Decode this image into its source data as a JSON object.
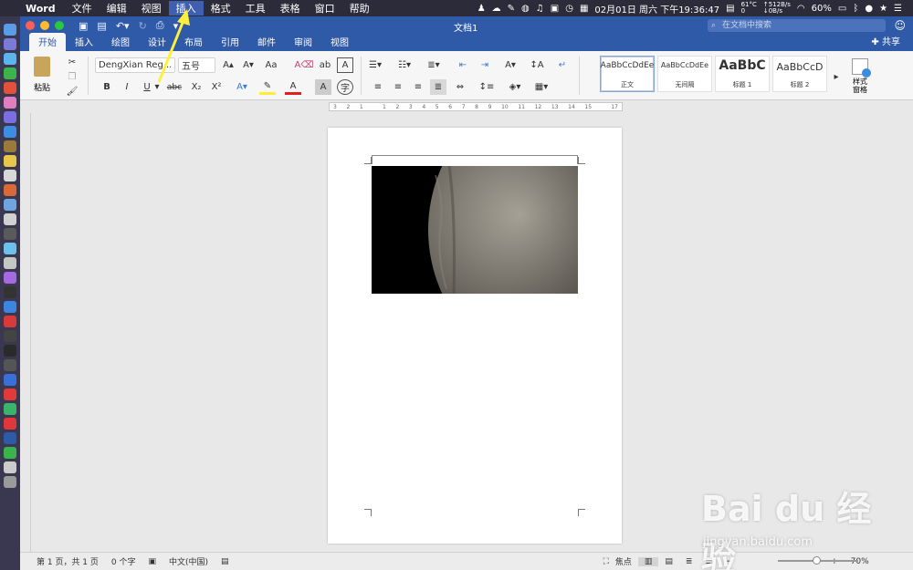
{
  "menubar": {
    "apple_symbol": "",
    "app_name": "Word",
    "items": [
      "文件",
      "编辑",
      "视图",
      "插入",
      "格式",
      "工具",
      "表格",
      "窗口",
      "帮助"
    ],
    "active_item": "插入",
    "temperature_top": "61°C",
    "temperature_bottom": "0",
    "net_up": "↑512B/s",
    "net_down": "↓0B/s",
    "datetime": "02月01日 周六 下午19:36:47",
    "battery": "60%"
  },
  "window": {
    "title": "文档1",
    "search_placeholder": "在文档中搜索",
    "share_label": "共享"
  },
  "tabs": [
    "开始",
    "插入",
    "绘图",
    "设计",
    "布局",
    "引用",
    "邮件",
    "审阅",
    "视图"
  ],
  "ribbon": {
    "paste_label": "粘贴",
    "font_name": "DengXian Reg...",
    "font_size": "五号",
    "bold": "B",
    "italic": "I",
    "underline": "U",
    "strike": "abc",
    "subscript": "X₂",
    "superscript": "X²",
    "styles": [
      {
        "sample": "AaBbCcDdEe",
        "name": "正文"
      },
      {
        "sample": "AaBbCcDdEe",
        "name": "无间隔"
      },
      {
        "sample": "AaBbC",
        "name": "标题 1"
      },
      {
        "sample": "AaBbCcD",
        "name": "标题 2"
      }
    ],
    "styles_pane_label": "样式\n窗格",
    "styles_pane_line1": "样式",
    "styles_pane_line2": "窗格"
  },
  "ruler_marks": [
    "3",
    "2",
    "1",
    "",
    "1",
    "2",
    "3",
    "4",
    "5",
    "6",
    "7",
    "8",
    "9",
    "10",
    "11",
    "12",
    "13",
    "14",
    "15",
    "",
    "17"
  ],
  "statusbar": {
    "page": "第 1 页，共 1 页",
    "words": "0 个字",
    "language": "中文(中国)",
    "focus": "焦点",
    "zoom": "70%"
  },
  "watermark": {
    "logo_text": "Bai du 经验",
    "url": "jingyan.baidu.com"
  },
  "colors": {
    "word_blue": "#2f5aa8",
    "menubar_bg": "#2b2b3a",
    "arrow": "#ffef3a"
  }
}
